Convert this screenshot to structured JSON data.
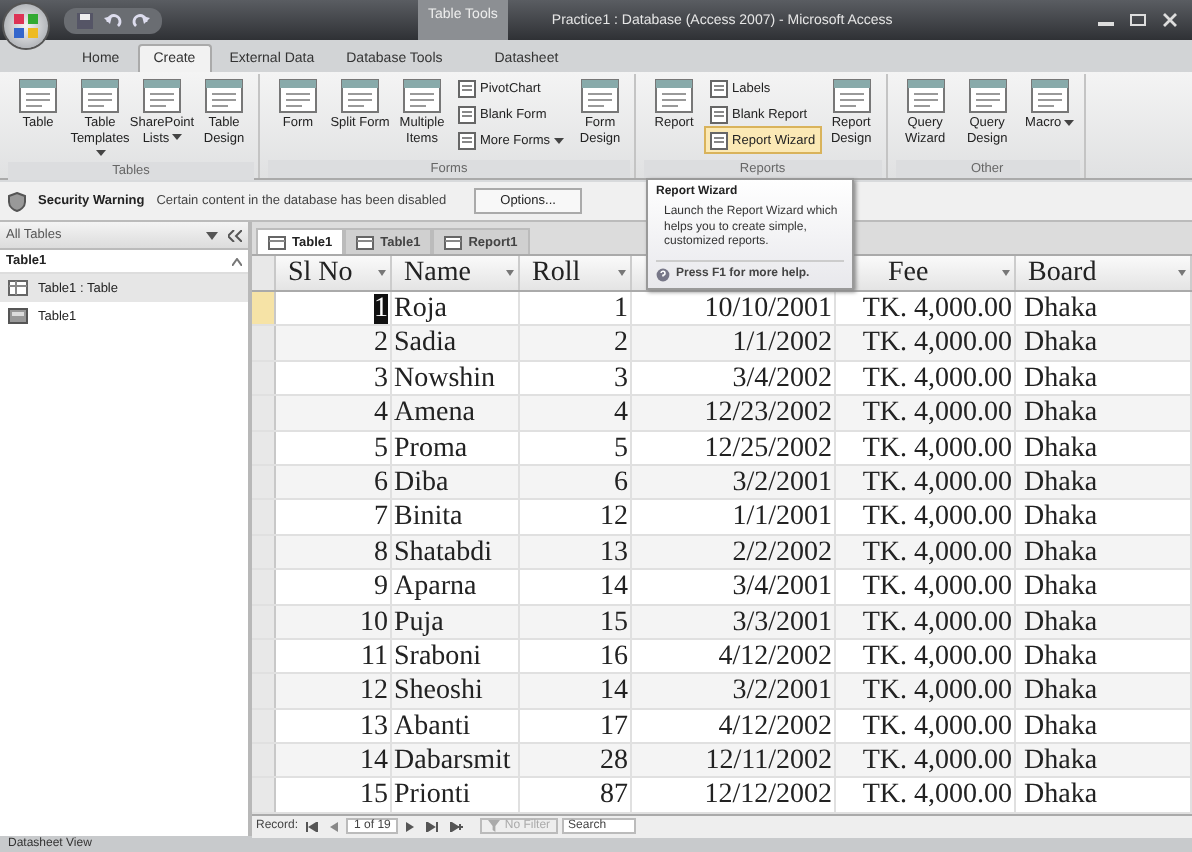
{
  "window": {
    "title": "Practice1 : Database (Access 2007) - Microsoft Access",
    "context_tab": "Table Tools"
  },
  "ribbon_tabs": [
    {
      "label": "Home",
      "selected": false
    },
    {
      "label": "Create",
      "selected": true
    },
    {
      "label": "External Data",
      "selected": false
    },
    {
      "label": "Database Tools",
      "selected": false
    },
    {
      "label": "Datasheet",
      "selected": false
    }
  ],
  "ribbon_groups": [
    {
      "label": "Tables",
      "buttons": [
        {
          "kind": "large",
          "label": "Table"
        },
        {
          "kind": "large",
          "label": "Table Templates",
          "dropdown": true
        },
        {
          "kind": "large",
          "label": "SharePoint Lists",
          "dropdown": true
        },
        {
          "kind": "large",
          "label": "Table Design"
        }
      ]
    },
    {
      "label": "Forms",
      "buttons": [
        {
          "kind": "large",
          "label": "Form"
        },
        {
          "kind": "large",
          "label": "Split Form"
        },
        {
          "kind": "large",
          "label": "Multiple Items"
        },
        {
          "kind": "small",
          "label": "PivotChart"
        },
        {
          "kind": "small",
          "label": "Blank Form"
        },
        {
          "kind": "small",
          "label": "More Forms",
          "dropdown": true
        },
        {
          "kind": "large",
          "label": "Form Design"
        }
      ]
    },
    {
      "label": "Reports",
      "buttons": [
        {
          "kind": "large",
          "label": "Report"
        },
        {
          "kind": "small",
          "label": "Labels"
        },
        {
          "kind": "small",
          "label": "Blank Report"
        },
        {
          "kind": "small",
          "label": "Report Wizard",
          "hovered": true
        },
        {
          "kind": "large",
          "label": "Report Design"
        }
      ]
    },
    {
      "label": "Other",
      "buttons": [
        {
          "kind": "large",
          "label": "Query Wizard"
        },
        {
          "kind": "large",
          "label": "Query Design"
        },
        {
          "kind": "large",
          "label": "Macro",
          "dropdown": true
        }
      ]
    }
  ],
  "security_bar": {
    "title": "Security Warning",
    "message": "Certain content in the database has been disabled",
    "button": "Options..."
  },
  "tooltip": {
    "title": "Report Wizard",
    "text": "Launch the Report Wizard which helps you to create simple, customized reports.",
    "help": "Press F1 for more help."
  },
  "navigation_pane": {
    "title": "All Tables",
    "group": "Table1",
    "items": [
      {
        "label": "Table1 : Table",
        "kind": "table",
        "selected": true
      },
      {
        "label": "Table1",
        "kind": "report",
        "selected": false
      }
    ]
  },
  "document_tabs": [
    {
      "label": "Table1",
      "selected": true
    },
    {
      "label": "Table1",
      "selected": false
    },
    {
      "label": "Report1",
      "selected": false
    }
  ],
  "table": {
    "columns": [
      {
        "label": "Sl No"
      },
      {
        "label": "Name"
      },
      {
        "label": "Roll"
      },
      {},
      {
        "label": "Fee"
      },
      {
        "label": "Board"
      }
    ],
    "rows": [
      {
        "selected": true,
        "cells": [
          "1",
          "Roja",
          "1",
          "10/10/2001",
          "TK. 4,000.00",
          "Dhaka"
        ]
      },
      {
        "selected": false,
        "cells": [
          "2",
          "Sadia",
          "2",
          "1/1/2002",
          "TK. 4,000.00",
          "Dhaka"
        ]
      },
      {
        "selected": false,
        "cells": [
          "3",
          "Nowshin",
          "3",
          "3/4/2002",
          "TK. 4,000.00",
          "Dhaka"
        ]
      },
      {
        "selected": false,
        "cells": [
          "4",
          "Amena",
          "4",
          "12/23/2002",
          "TK. 4,000.00",
          "Dhaka"
        ]
      },
      {
        "selected": false,
        "cells": [
          "5",
          "Proma",
          "5",
          "12/25/2002",
          "TK. 4,000.00",
          "Dhaka"
        ]
      },
      {
        "selected": false,
        "cells": [
          "6",
          "Diba",
          "6",
          "3/2/2001",
          "TK. 4,000.00",
          "Dhaka"
        ]
      },
      {
        "selected": false,
        "cells": [
          "7",
          "Binita",
          "12",
          "1/1/2001",
          "TK. 4,000.00",
          "Dhaka"
        ]
      },
      {
        "selected": false,
        "cells": [
          "8",
          "Shatabdi",
          "13",
          "2/2/2002",
          "TK. 4,000.00",
          "Dhaka"
        ]
      },
      {
        "selected": false,
        "cells": [
          "9",
          "Aparna",
          "14",
          "3/4/2001",
          "TK. 4,000.00",
          "Dhaka"
        ]
      },
      {
        "selected": false,
        "cells": [
          "10",
          "Puja",
          "15",
          "3/3/2001",
          "TK. 4,000.00",
          "Dhaka"
        ]
      },
      {
        "selected": false,
        "cells": [
          "11",
          "Sraboni",
          "16",
          "4/12/2002",
          "TK. 4,000.00",
          "Dhaka"
        ]
      },
      {
        "selected": false,
        "cells": [
          "12",
          "Sheoshi",
          "14",
          "3/2/2001",
          "TK. 4,000.00",
          "Dhaka"
        ]
      },
      {
        "selected": false,
        "cells": [
          "13",
          "Abanti",
          "17",
          "4/12/2002",
          "TK. 4,000.00",
          "Dhaka"
        ]
      },
      {
        "selected": false,
        "cells": [
          "14",
          "Dabarsmit",
          "28",
          "12/11/2002",
          "TK. 4,000.00",
          "Dhaka"
        ]
      },
      {
        "selected": false,
        "cells": [
          "15",
          "Prionti",
          "87",
          "12/12/2002",
          "TK. 4,000.00",
          "Dhaka"
        ]
      }
    ]
  },
  "record_navigator": {
    "label": "Record:",
    "position": "1 of 19",
    "filter": "No Filter",
    "filter_enabled": false,
    "search": "Search"
  },
  "status_bar": {
    "text": "Datasheet View"
  }
}
